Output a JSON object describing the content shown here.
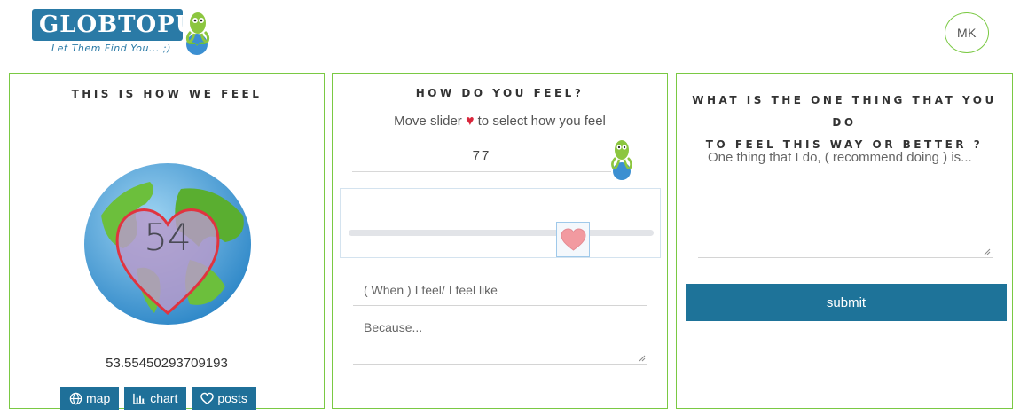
{
  "header": {
    "logo_text": "GLOBTOPUS",
    "tagline": "Let Them Find You... ;)",
    "user_initials": "MK"
  },
  "panel1": {
    "title": "THIS IS HOW WE FEEL",
    "globe_value": "54",
    "average": "53.55450293709193",
    "buttons": [
      {
        "label": "map",
        "icon": "globe-icon"
      },
      {
        "label": "chart",
        "icon": "bar-chart-icon"
      },
      {
        "label": "posts",
        "icon": "heart-outline-icon"
      }
    ]
  },
  "panel2": {
    "title": "HOW DO YOU FEEL?",
    "instruction_before": "Move slider",
    "instruction_after": "to select how you feel",
    "value": "77",
    "slider_value": 77,
    "feel_placeholder": "( When ) I feel/ I feel like",
    "because_placeholder": "Because..."
  },
  "panel3": {
    "title_line1": "WHAT IS THE ONE THING THAT YOU DO",
    "title_line2": "TO FEEL THIS WAY OR BETTER ?",
    "placeholder": "One thing that I do, ( recommend doing ) is...",
    "submit_label": "submit"
  },
  "colors": {
    "accent_green": "#7ac943",
    "brand_blue": "#1f7099",
    "heart_red": "#d9263b"
  }
}
